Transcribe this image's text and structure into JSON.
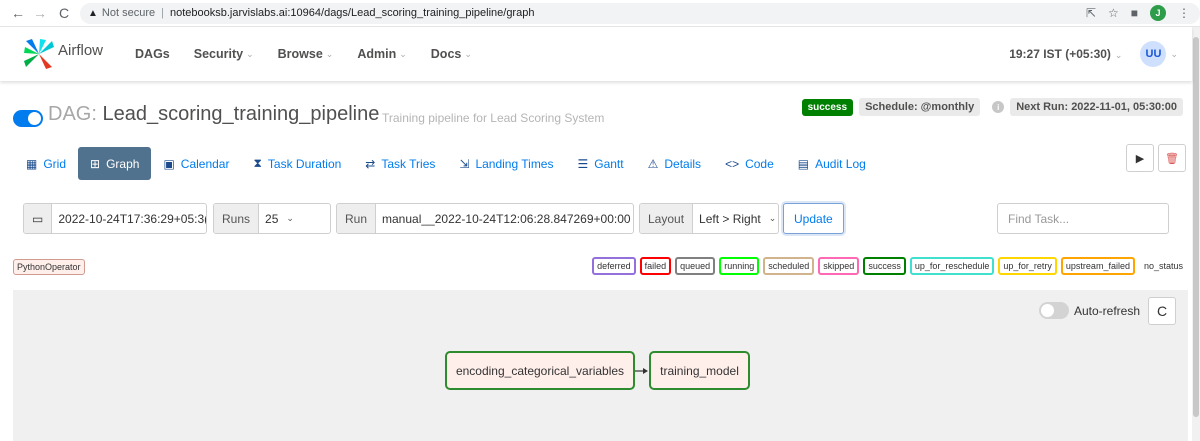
{
  "browser": {
    "security_label": "Not secure",
    "url": "notebooksb.jarvislabs.ai:10964/dags/Lead_scoring_training_pipeline/graph",
    "profile_initial": "J"
  },
  "navbar": {
    "brand": "Airflow",
    "menu": [
      "DAGs",
      "Security",
      "Browse",
      "Admin",
      "Docs"
    ],
    "clock": "19:27 IST (+05:30)",
    "user_initials": "UU"
  },
  "dag": {
    "prefix": "DAG:",
    "id": "Lead_scoring_training_pipeline",
    "description": "Training pipeline for Lead Scoring System",
    "status": "success",
    "schedule": "Schedule: @monthly",
    "next_run": "Next Run: 2022-11-01, 05:30:00"
  },
  "tabs": [
    "Grid",
    "Graph",
    "Calendar",
    "Task Duration",
    "Task Tries",
    "Landing Times",
    "Gantt",
    "Details",
    "Code",
    "Audit Log"
  ],
  "controls": {
    "base_date": "2022-10-24T17:36:29+05:3(",
    "runs_label": "Runs",
    "runs_value": "25",
    "run_label": "Run",
    "run_value": "manual__2022-10-24T12:06:28.847269+00:00",
    "layout_label": "Layout",
    "layout_value": "Left > Right",
    "update": "Update",
    "find_placeholder": "Find Task..."
  },
  "operator": "PythonOperator",
  "states": [
    {
      "name": "deferred",
      "color": "#9370db"
    },
    {
      "name": "failed",
      "color": "#ff0000"
    },
    {
      "name": "queued",
      "color": "#808080"
    },
    {
      "name": "running",
      "color": "#00ff00"
    },
    {
      "name": "scheduled",
      "color": "#d2b48c"
    },
    {
      "name": "skipped",
      "color": "#ff69b4"
    },
    {
      "name": "success",
      "color": "#008000"
    },
    {
      "name": "up_for_reschedule",
      "color": "#40e0d0"
    },
    {
      "name": "up_for_retry",
      "color": "#ffd700"
    },
    {
      "name": "upstream_failed",
      "color": "#ffa500"
    },
    {
      "name": "no_status",
      "color": ""
    }
  ],
  "graph": {
    "auto_refresh": "Auto-refresh",
    "nodes": [
      "encoding_categorical_variables",
      "training_model"
    ]
  }
}
